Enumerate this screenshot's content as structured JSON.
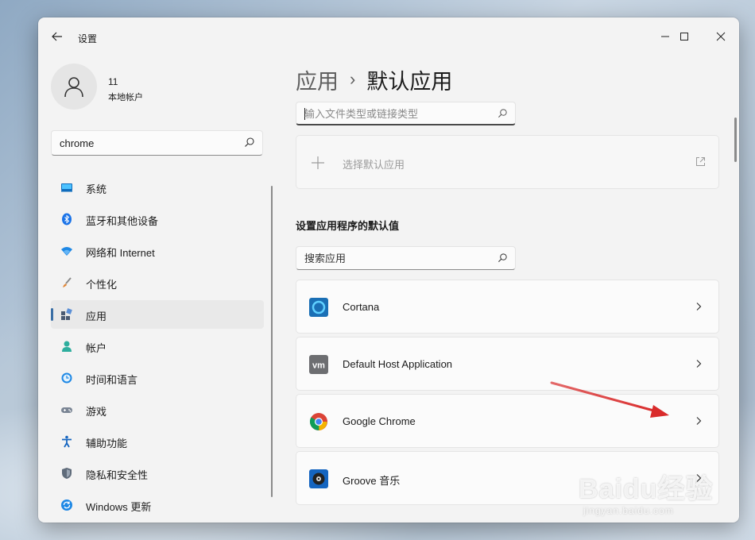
{
  "window": {
    "title": "设置"
  },
  "profile": {
    "name": "11",
    "account_type": "本地帐户"
  },
  "sidebar": {
    "search_value": "chrome",
    "items": [
      {
        "label": "系统",
        "icon": "system-icon",
        "color": "#0f6cbd"
      },
      {
        "label": "蓝牙和其他设备",
        "icon": "bluetooth-icon",
        "color": "#1a73e8"
      },
      {
        "label": "网络和 Internet",
        "icon": "wifi-icon",
        "color": "#1e88e5"
      },
      {
        "label": "个性化",
        "icon": "brush-icon",
        "color": "#e0883a"
      },
      {
        "label": "应用",
        "icon": "apps-icon",
        "color": "#4a5a72",
        "selected": true
      },
      {
        "label": "帐户",
        "icon": "person-icon",
        "color": "#2eae9e"
      },
      {
        "label": "时间和语言",
        "icon": "clock-globe-icon",
        "color": "#1e88e5"
      },
      {
        "label": "游戏",
        "icon": "gamepad-icon",
        "color": "#7a8594"
      },
      {
        "label": "辅助功能",
        "icon": "accessibility-icon",
        "color": "#1565c0"
      },
      {
        "label": "隐私和安全性",
        "icon": "shield-icon",
        "color": "#5f6b7a"
      },
      {
        "label": "Windows 更新",
        "icon": "update-icon",
        "color": "#1e88e5"
      }
    ]
  },
  "main": {
    "breadcrumb": {
      "parent": "应用",
      "separator": "›",
      "current": "默认应用"
    },
    "filetype_search_placeholder": "输入文件类型或链接类型",
    "choose_default_label": "选择默认应用",
    "section_title": "设置应用程序的默认值",
    "app_search_placeholder": "搜索应用",
    "apps": [
      {
        "name": "Cortana",
        "icon": "cortana-icon"
      },
      {
        "name": "Default Host Application",
        "icon": "vmware-icon"
      },
      {
        "name": "Google Chrome",
        "icon": "chrome-icon"
      },
      {
        "name": "Groove 音乐",
        "icon": "groove-music-icon"
      }
    ]
  },
  "colors": {
    "accent": "#3a6ea5",
    "annotation_arrow": "#d92b2b"
  },
  "watermark": {
    "main": "Baidu经验",
    "sub": "jingyan.baidu.com"
  }
}
